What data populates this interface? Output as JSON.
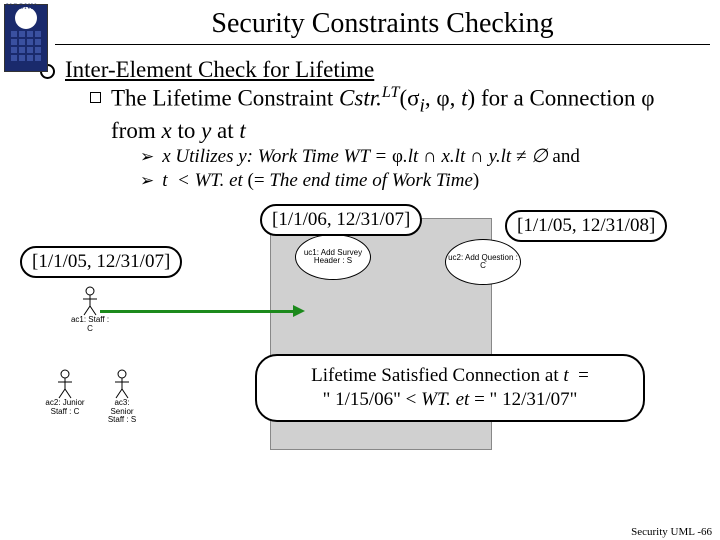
{
  "logo_text": "UCONN",
  "title": "Security Constraints Checking",
  "heading": "Inter-Element Check for Lifetime",
  "sub1_html": "The Lifetime Constraint <i>Cstr.</i><sup><i>LT</i></sup>(σ<sub><i>i</i></sub>, φ, <i>t</i>) for a Connection φ from <i>x</i> to <i>y</i> at <i>t</i>",
  "sub2a_html": "x Utilizes y: Work Time WT = <span style='font-style:normal'>φ</span>.lt ∩ x.lt ∩ y.lt ≠ ∅ <span style='font-style:normal'>and</span>",
  "sub2b_html": "t &nbsp;&lt; WT. et <span style='font-style:normal'>(=</span> The end time of Work Time<span style='font-style:normal'>)</span>",
  "pills": {
    "left": "[1/1/05, 12/31/07]",
    "mid": "[1/1/06, 12/31/07]",
    "right": "[1/1/05, 12/31/08]"
  },
  "result_html": "Lifetime Satisfied Connection at <i>t</i>&nbsp; = <br>\" 1/15/06\" &lt; <i>WT. et</i> = \" 12/31/07\"",
  "usecases": {
    "uc1": "uc1: Add Survey Header : S",
    "uc2": "uc2: Add Question : C"
  },
  "actors": {
    "ac1": "ac1: Staff : C",
    "ac2": "ac2: Junior Staff : C",
    "ac3": "ac3: Senior Staff : S"
  },
  "footer": "Security UML -66"
}
